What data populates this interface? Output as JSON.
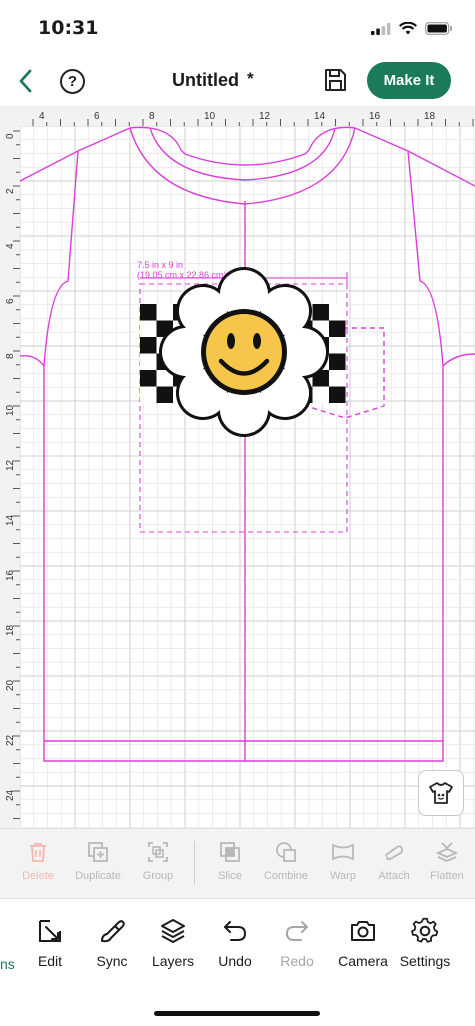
{
  "status_bar": {
    "time": "10:31"
  },
  "header": {
    "title": "Untitled",
    "unsaved_marker": "*",
    "make_it_label": "Make It",
    "help_label": "?"
  },
  "canvas": {
    "ruler_top": [
      "4",
      "6",
      "8",
      "10",
      "12",
      "14",
      "16",
      "18"
    ],
    "ruler_left": [
      "0",
      "2",
      "4",
      "6",
      "8",
      "10",
      "12",
      "14",
      "16",
      "18",
      "20",
      "22",
      "24"
    ],
    "selection_size_line1": "7.5 in x 9 in",
    "selection_size_line2": "(19.05 cm x 22.86 cm)"
  },
  "edit_toolbar": {
    "items": [
      {
        "label": "Delete",
        "icon": "trash-icon"
      },
      {
        "label": "Duplicate",
        "icon": "duplicate-icon"
      },
      {
        "label": "Group",
        "icon": "group-icon"
      },
      {
        "label": "Slice",
        "icon": "slice-icon"
      },
      {
        "label": "Combine",
        "icon": "combine-icon"
      },
      {
        "label": "Warp",
        "icon": "warp-icon"
      },
      {
        "label": "Attach",
        "icon": "attach-icon"
      },
      {
        "label": "Flatten",
        "icon": "flatten-icon"
      }
    ]
  },
  "bottom_nav": {
    "edge_label": "ns",
    "items": [
      {
        "label": "Edit",
        "icon": "edit-icon"
      },
      {
        "label": "Sync",
        "icon": "sync-icon"
      },
      {
        "label": "Layers",
        "icon": "layers-icon"
      },
      {
        "label": "Undo",
        "icon": "undo-icon"
      },
      {
        "label": "Redo",
        "icon": "redo-icon"
      },
      {
        "label": "Camera",
        "icon": "camera-icon"
      },
      {
        "label": "Settings",
        "icon": "settings-icon"
      }
    ]
  },
  "colors": {
    "accent": "#1b7a5a",
    "guide_pink": "#d93fd9",
    "smiley_yellow": "#f5c64a"
  }
}
